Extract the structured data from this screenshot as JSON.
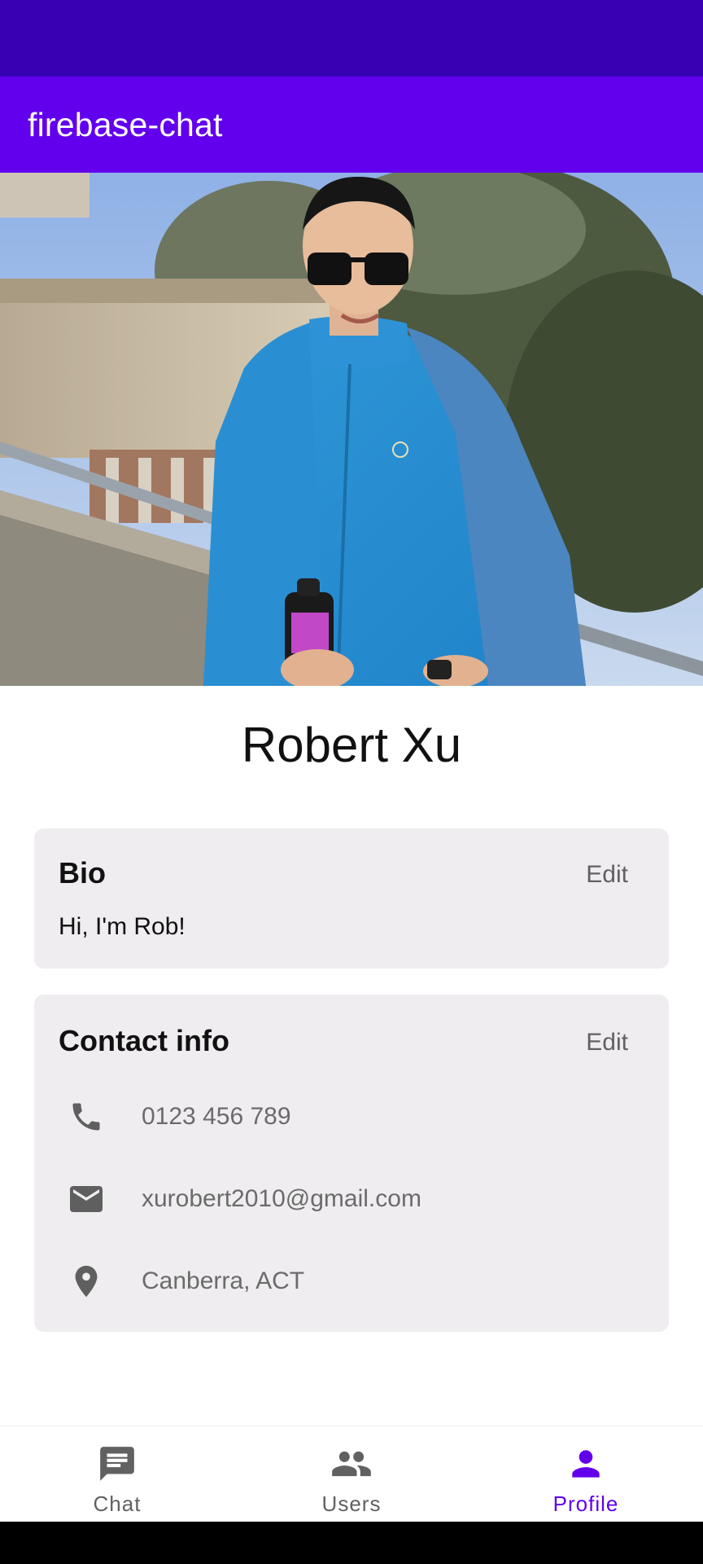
{
  "app": {
    "title": "firebase-chat"
  },
  "profile": {
    "photo": "profile-photo",
    "name": "Robert Xu"
  },
  "bio": {
    "title": "Bio",
    "edit_label": "Edit",
    "text": "Hi, I'm Rob!"
  },
  "contact": {
    "title": "Contact info",
    "edit_label": "Edit",
    "items": [
      {
        "icon": "phone-icon",
        "value": "0123 456 789"
      },
      {
        "icon": "email-icon",
        "value": "xurobert2010@gmail.com"
      },
      {
        "icon": "location-pin-icon",
        "value": "Canberra, ACT"
      }
    ]
  },
  "nav": {
    "items": [
      {
        "icon": "chat-icon",
        "label": "Chat",
        "active": false
      },
      {
        "icon": "users-icon",
        "label": "Users",
        "active": false
      },
      {
        "icon": "person-icon",
        "label": "Profile",
        "active": true
      }
    ]
  },
  "colors": {
    "status_bar": "#3700b3",
    "app_bar": "#6200ee",
    "accent": "#6200ee",
    "card_bg": "#efedef",
    "muted_text": "#616161"
  }
}
